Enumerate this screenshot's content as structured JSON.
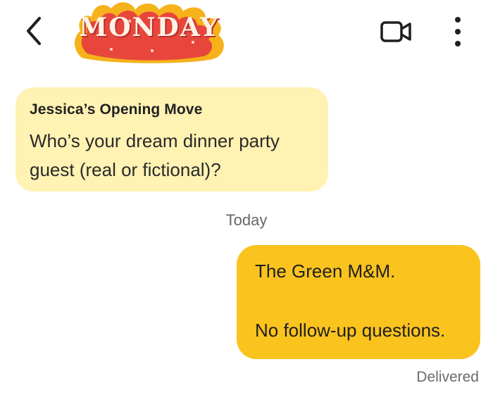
{
  "header": {
    "back_icon": "chevron-left-icon",
    "sticker_text": "MONDAY",
    "video_icon": "video-camera-icon",
    "more_icon": "more-vertical-icon"
  },
  "messages": {
    "incoming": {
      "title": "Jessica’s Opening Move",
      "lines": [
        "Who’s your dream dinner party",
        "guest (real or fictional)?"
      ]
    },
    "day_label": "Today",
    "outgoing": {
      "lines": [
        "The Green M&M.",
        "No follow-up questions."
      ],
      "status": "Delivered"
    }
  },
  "colors": {
    "incoming_bubble": "#fff2b3",
    "outgoing_bubble": "#fbc31e",
    "sticker_red": "#e8463c"
  }
}
